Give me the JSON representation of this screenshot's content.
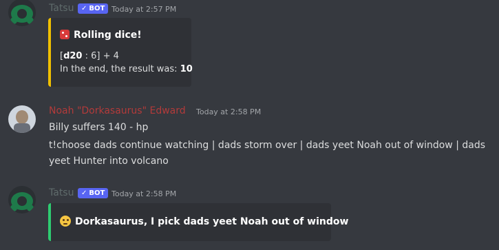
{
  "messages": [
    {
      "author": "Tatsu",
      "badge": "BOT",
      "badge_check": "✓",
      "timestamp": "Today at 2:57 PM",
      "embed": {
        "color": "#f0c000",
        "title": "Rolling dice!",
        "roll_prefix": "[",
        "roll_die": "d20",
        "roll_mid": " : 6] + 4",
        "result_prefix": "In the end, the result was: ",
        "result_value": "10"
      }
    },
    {
      "author": "Noah \"Dorkasaurus\" Edward",
      "author_color": "#b33a3a",
      "timestamp": "Today at 2:58 PM",
      "lines": [
        "Billy suffers 140 - hp",
        "t!choose dads continue watching | dads storm over | dads yeet Noah out of window | dads",
        "yeet Hunter into volcano"
      ]
    },
    {
      "author": "Tatsu",
      "badge": "BOT",
      "badge_check": "✓",
      "timestamp": "Today at 2:58 PM",
      "embed": {
        "color": "#2ecc71",
        "prefix": "Dorkasaurus, I pick ",
        "choice": "dads yeet Noah out of window"
      }
    }
  ]
}
